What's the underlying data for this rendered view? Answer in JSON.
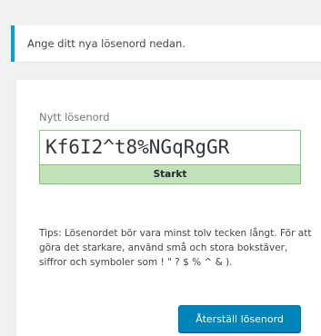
{
  "notice": {
    "message": "Ange ditt nya lösenord nedan."
  },
  "form": {
    "password_label": "Nytt lösenord",
    "password_value": "Kf6I2^t8%NGqRgGR",
    "strength_label": "Starkt",
    "hint": "Tips: Lösenordet bör vara minst tolv tecken långt. För att göra det starkare, använd små och stora bokstäver, siffror och symboler som ! \" ? $ % ^ & ).",
    "submit_label": "Återställ lösenord"
  },
  "colors": {
    "notice_accent": "#00a0d2",
    "strength_bg": "#c1e1b9",
    "strength_border": "#83c373",
    "button_bg": "#0085ba"
  }
}
